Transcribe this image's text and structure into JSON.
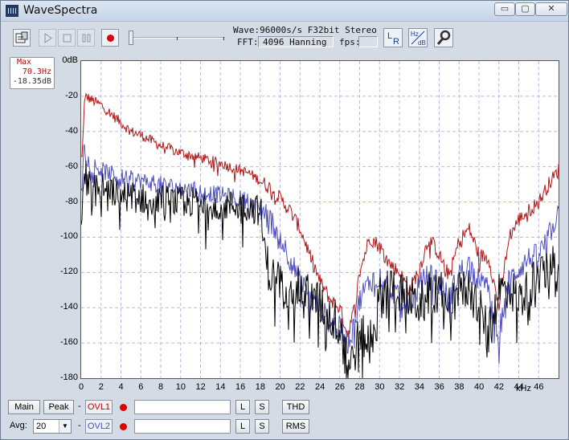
{
  "window": {
    "title": "WaveSpectra"
  },
  "titlebar_buttons": {
    "minimize": "▭",
    "maximize": "▢",
    "close": "✕"
  },
  "status": {
    "wave_label": "Wave:",
    "wave_value": "96000s/s F32bit Stereo",
    "fft_label": "FFT:",
    "fft_value": "4096 Hanning",
    "fps_label": "fps:",
    "fps_value": ""
  },
  "peak": {
    "label": "Max",
    "freq": "70.3Hz",
    "level": "-18.35dB"
  },
  "toolbar": {
    "lr_label": "L R",
    "hzdb_top": "Hz",
    "hzdb_bottom": "dB"
  },
  "bottom": {
    "main_label": "Main",
    "peak_label": "Peak",
    "avg_label": "Avg:",
    "avg_value": "20",
    "ovl1_label": "OVL1",
    "ovl2_label": "OVL2",
    "l_label": "L",
    "s_label": "S",
    "thd_label": "THD",
    "rms_label": "RMS",
    "dash": "-"
  },
  "chart_data": {
    "type": "line",
    "xlabel": "kHz",
    "ylabel_unit": "dB",
    "xlim": [
      0,
      48
    ],
    "ylim": [
      -180,
      0
    ],
    "x_ticks": [
      "0",
      "2",
      "4",
      "6",
      "8",
      "10",
      "12",
      "14",
      "16",
      "18",
      "20",
      "22",
      "24",
      "26",
      "28",
      "30",
      "32",
      "34",
      "36",
      "38",
      "40",
      "42",
      "44",
      "46"
    ],
    "y_ticks": [
      "0dB",
      "-20",
      "-40",
      "-60",
      "-80",
      "-100",
      "-120",
      "-140",
      "-160",
      "-180"
    ],
    "grid": true,
    "series": [
      {
        "color": "#b01818",
        "x": [
          0.1,
          0.3,
          0.5,
          1,
          2,
          3,
          4,
          5,
          6,
          7,
          8,
          10,
          12,
          14,
          16,
          17,
          18,
          19,
          20,
          21,
          22,
          23,
          24,
          25,
          26,
          26.8,
          27.5,
          28,
          29,
          30,
          31,
          32,
          33,
          34,
          35,
          36,
          37,
          38,
          39,
          40,
          41,
          42,
          43,
          44,
          45,
          46,
          47,
          48
        ],
        "y": [
          -55,
          -25,
          -20,
          -22,
          -25,
          -30,
          -35,
          -40,
          -42,
          -45,
          -48,
          -52,
          -55,
          -58,
          -62,
          -64,
          -68,
          -72,
          -78,
          -85,
          -95,
          -110,
          -125,
          -135,
          -140,
          -155,
          -140,
          -120,
          -100,
          -105,
          -115,
          -120,
          -130,
          -118,
          -100,
          -110,
          -122,
          -102,
          -95,
          -110,
          -112,
          -140,
          -100,
          -90,
          -85,
          -80,
          -70,
          -62
        ]
      },
      {
        "color": "#5050c0",
        "x": [
          0.1,
          0.3,
          0.5,
          1,
          2,
          3,
          4,
          6,
          8,
          10,
          12,
          14,
          16,
          17,
          18,
          19,
          20,
          21,
          22,
          23,
          24,
          25,
          26,
          26.8,
          27.5,
          28,
          29,
          30,
          31,
          32,
          33,
          34,
          35,
          36,
          37,
          38,
          39,
          40,
          41,
          42,
          43,
          44,
          45,
          46,
          47,
          48
        ],
        "y": [
          -70,
          -45,
          -55,
          -58,
          -62,
          -64,
          -66,
          -68,
          -70,
          -72,
          -74,
          -76,
          -78,
          -80,
          -84,
          -90,
          -100,
          -112,
          -125,
          -135,
          -140,
          -148,
          -152,
          -160,
          -150,
          -135,
          -125,
          -122,
          -128,
          -135,
          -140,
          -128,
          -120,
          -125,
          -135,
          -120,
          -115,
          -125,
          -130,
          -155,
          -125,
          -118,
          -112,
          -110,
          -100,
          -85
        ]
      },
      {
        "color": "#000000",
        "x": [
          0.1,
          0.3,
          0.5,
          1,
          2,
          3,
          4,
          6,
          8,
          10,
          12,
          14,
          16,
          17,
          18,
          18.5,
          19,
          20,
          21,
          22,
          23,
          24,
          25,
          26,
          26.8,
          27.5,
          28,
          29,
          30,
          31,
          32,
          33,
          34,
          35,
          36,
          37,
          38,
          39,
          40,
          41,
          42,
          43,
          44,
          45,
          46,
          47,
          48
        ],
        "y": [
          -85,
          -60,
          -65,
          -70,
          -72,
          -74,
          -76,
          -78,
          -79,
          -80,
          -80,
          -82,
          -82,
          -83,
          -85,
          -110,
          -122,
          -125,
          -128,
          -130,
          -133,
          -138,
          -145,
          -150,
          -175,
          -165,
          -155,
          -160,
          -135,
          -128,
          -130,
          -135,
          -138,
          -132,
          -130,
          -138,
          -132,
          -128,
          -140,
          -155,
          -130,
          -128,
          -135,
          -130,
          -120,
          -120,
          -110
        ]
      }
    ]
  }
}
